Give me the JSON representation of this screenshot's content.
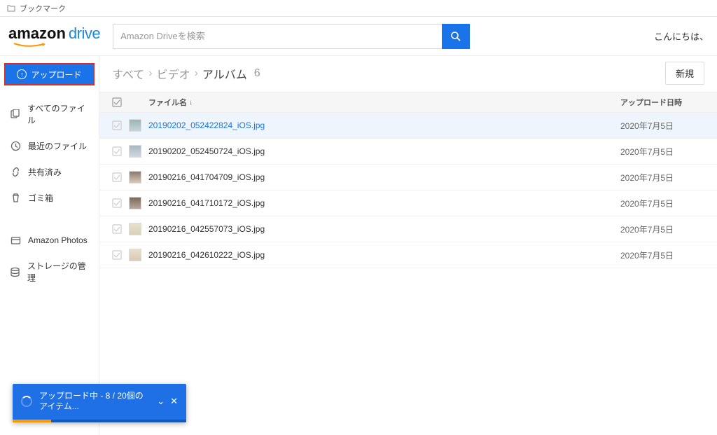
{
  "bookmark_label": "ブックマーク",
  "logo": {
    "amazon": "amazon",
    "drive": "drive"
  },
  "search": {
    "placeholder": "Amazon Driveを検索"
  },
  "greeting": "こんにちは、",
  "upload_button": "アップロード",
  "sidebar": {
    "items": [
      {
        "label": "すべてのファイル"
      },
      {
        "label": "最近のファイル"
      },
      {
        "label": "共有済み"
      },
      {
        "label": "ゴミ箱"
      }
    ],
    "section2": [
      {
        "label": "Amazon Photos"
      },
      {
        "label": "ストレージの管理"
      }
    ]
  },
  "breadcrumb": {
    "all": "すべて",
    "video": "ビデオ",
    "album": "アルバム",
    "count": "6"
  },
  "new_button": "新規",
  "columns": {
    "name": "ファイル名",
    "date": "アップロード日時"
  },
  "files": [
    {
      "name": "20190202_052422824_iOS.jpg",
      "date": "2020年7月5日",
      "thumb": "thumb-1",
      "highlighted": true
    },
    {
      "name": "20190202_052450724_iOS.jpg",
      "date": "2020年7月5日",
      "thumb": "thumb-2"
    },
    {
      "name": "20190216_041704709_iOS.jpg",
      "date": "2020年7月5日",
      "thumb": "thumb-3"
    },
    {
      "name": "20190216_041710172_iOS.jpg",
      "date": "2020年7月5日",
      "thumb": "thumb-4"
    },
    {
      "name": "20190216_042557073_iOS.jpg",
      "date": "2020年7月5日",
      "thumb": "thumb-5"
    },
    {
      "name": "20190216_042610222_iOS.jpg",
      "date": "2020年7月5日",
      "thumb": "thumb-6"
    }
  ],
  "toast": {
    "text": "アップロード中 - 8 / 20個のアイテム..."
  }
}
